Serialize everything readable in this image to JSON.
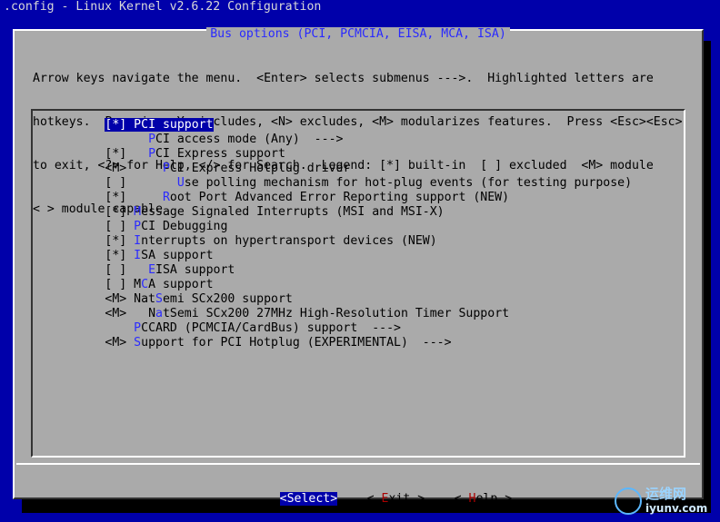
{
  "window": {
    "title": ".config - Linux Kernel v2.6.22 Configuration"
  },
  "dialog": {
    "title": "Bus options (PCI, PCMCIA, EISA, MCA, ISA)",
    "help_lines": [
      "Arrow keys navigate the menu.  <Enter> selects submenus --->.  Highlighted letters are",
      "hotkeys.  Pressing <Y> includes, <N> excludes, <M> modularizes features.  Press <Esc><Esc>",
      "to exit, <?> for Help, </> for Search.  Legend: [*] built-in  [ ] excluded  <M> module",
      "< > module capable"
    ]
  },
  "menu": {
    "items": [
      {
        "prefix": "[*] ",
        "indent": "",
        "hotkey": "P",
        "rest": "CI support",
        "selected": true
      },
      {
        "prefix": "    ",
        "indent": "  ",
        "hotkey": "P",
        "rest": "CI access mode (Any)  --->",
        "selected": false
      },
      {
        "prefix": "[*] ",
        "indent": "  ",
        "hotkey": "P",
        "rest": "CI Express support",
        "selected": false
      },
      {
        "prefix": "<M> ",
        "indent": "    ",
        "hotkey": "P",
        "rest": "CI Express Hotplug driver",
        "selected": false
      },
      {
        "prefix": "[ ] ",
        "indent": "      ",
        "hotkey": "U",
        "rest": "se polling mechanism for hot-plug events (for testing purpose)",
        "selected": false
      },
      {
        "prefix": "[*] ",
        "indent": "    ",
        "hotkey": "R",
        "rest": "oot Port Advanced Error Reporting support (NEW)",
        "selected": false
      },
      {
        "prefix": "[*] ",
        "indent": "",
        "hotkey": "M",
        "rest": "essage Signaled Interrupts (MSI and MSI-X)",
        "selected": false
      },
      {
        "prefix": "[ ] ",
        "indent": "",
        "hotkey": "P",
        "rest": "CI Debugging",
        "selected": false
      },
      {
        "prefix": "[*] ",
        "indent": "",
        "hotkey": "I",
        "rest": "nterrupts on hypertransport devices (NEW)",
        "selected": false
      },
      {
        "prefix": "[*] ",
        "indent": "",
        "hotkey": "I",
        "rest": "SA support",
        "selected": false
      },
      {
        "prefix": "[ ] ",
        "indent": "  ",
        "hotkey": "E",
        "rest": "ISA support",
        "selected": false
      },
      {
        "prefix": "[ ] ",
        "indent": "",
        "hotkey_pre": "M",
        "hotkey": "C",
        "rest": "A support",
        "selected": false
      },
      {
        "prefix": "<M> ",
        "indent": "",
        "hotkey_pre": "Nat",
        "hotkey": "S",
        "rest": "emi SCx200 support",
        "selected": false
      },
      {
        "prefix": "<M> ",
        "indent": "  ",
        "hotkey_pre": "N",
        "hotkey": "a",
        "rest": "tSemi SCx200 27MHz High-Resolution Timer Support",
        "selected": false
      },
      {
        "prefix": "    ",
        "indent": "",
        "hotkey": "P",
        "rest": "CCARD (PCMCIA/CardBus) support  --->",
        "selected": false
      },
      {
        "prefix": "<M> ",
        "indent": "",
        "hotkey": "S",
        "rest": "upport for PCI Hotplug (EXPERIMENTAL)  --->",
        "selected": false
      }
    ]
  },
  "buttons": {
    "select": {
      "left": "<",
      "hotkey": "S",
      "rest": "elect",
      "right": ">"
    },
    "exit": {
      "left": "< ",
      "hotkey": "E",
      "rest": "xit",
      "right": " >"
    },
    "help": {
      "left": "< ",
      "hotkey": "H",
      "rest": "elp",
      "right": " >"
    }
  },
  "watermark": {
    "line1": "运维网",
    "line2": "iyunv.com"
  }
}
